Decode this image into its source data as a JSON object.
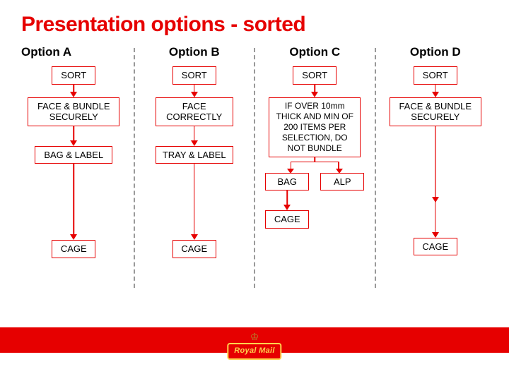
{
  "title": "Presentation options - sorted",
  "columns": {
    "a": {
      "head": "Option A",
      "sort": "SORT",
      "step1": "FACE & BUNDLE SECURELY",
      "step2": "BAG & LABEL",
      "cage": "CAGE"
    },
    "b": {
      "head": "Option B",
      "sort": "SORT",
      "step1": "FACE CORRECTLY",
      "step2": "TRAY & LABEL",
      "cage": "CAGE"
    },
    "c": {
      "head": "Option C",
      "sort": "SORT",
      "rule": "IF OVER 10mm THICK AND MIN OF 200 ITEMS PER SELECTION, DO NOT BUNDLE",
      "bag": "BAG",
      "alp": "ALP",
      "cage": "CAGE"
    },
    "d": {
      "head": "Option D",
      "sort": "SORT",
      "step1": "FACE & BUNDLE SECURELY",
      "cage": "CAGE"
    }
  },
  "logo_text": "Royal Mail"
}
